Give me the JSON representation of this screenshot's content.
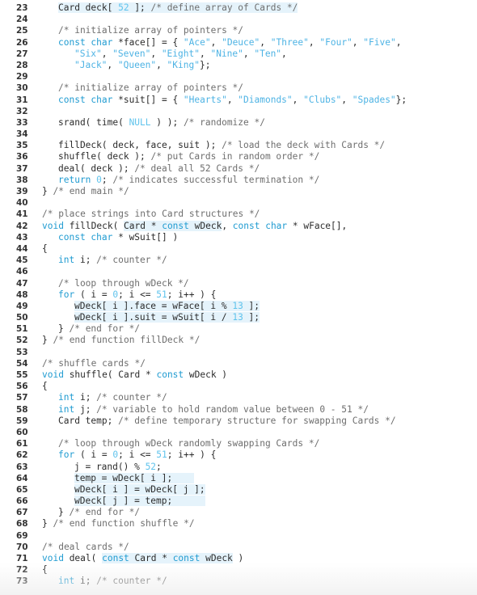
{
  "listing": {
    "colors": {
      "keyword": "#1f9bd1",
      "number": "#5fc3ec",
      "string": "#4db3e4",
      "comment": "#6e6e6e",
      "text": "#2b2b2b",
      "highlight": "#e5f3fb"
    },
    "lines": [
      {
        "n": "23",
        "indent": 1,
        "tokens": [
          {
            "t": "Card deck[ ",
            "c": "",
            "h": true
          },
          {
            "t": "52",
            "c": "num",
            "h": true
          },
          {
            "t": " ]; /* define array of Cards */",
            "c": "",
            "h": true,
            "split": "cm"
          }
        ]
      },
      {
        "n": "24",
        "indent": 0,
        "tokens": []
      },
      {
        "n": "25",
        "indent": 1,
        "tokens": [
          {
            "t": "/* initialize array of pointers */",
            "c": "cm"
          }
        ]
      },
      {
        "n": "26",
        "indent": 1,
        "tokens": [
          {
            "t": "const char",
            "c": "kw"
          },
          {
            "t": " *face[] = { ",
            "c": ""
          },
          {
            "t": "\"Ace\"",
            "c": "str"
          },
          {
            "t": ", ",
            "c": ""
          },
          {
            "t": "\"Deuce\"",
            "c": "str"
          },
          {
            "t": ", ",
            "c": ""
          },
          {
            "t": "\"Three\"",
            "c": "str"
          },
          {
            "t": ", ",
            "c": ""
          },
          {
            "t": "\"Four\"",
            "c": "str"
          },
          {
            "t": ", ",
            "c": ""
          },
          {
            "t": "\"Five\"",
            "c": "str"
          },
          {
            "t": ",",
            "c": ""
          }
        ]
      },
      {
        "n": "27",
        "indent": 2,
        "tokens": [
          {
            "t": "\"Six\"",
            "c": "str"
          },
          {
            "t": ", ",
            "c": ""
          },
          {
            "t": "\"Seven\"",
            "c": "str"
          },
          {
            "t": ", ",
            "c": ""
          },
          {
            "t": "\"Eight\"",
            "c": "str"
          },
          {
            "t": ", ",
            "c": ""
          },
          {
            "t": "\"Nine\"",
            "c": "str"
          },
          {
            "t": ", ",
            "c": ""
          },
          {
            "t": "\"Ten\"",
            "c": "str"
          },
          {
            "t": ",",
            "c": ""
          }
        ]
      },
      {
        "n": "28",
        "indent": 2,
        "tokens": [
          {
            "t": "\"Jack\"",
            "c": "str"
          },
          {
            "t": ", ",
            "c": ""
          },
          {
            "t": "\"Queen\"",
            "c": "str"
          },
          {
            "t": ", ",
            "c": ""
          },
          {
            "t": "\"King\"",
            "c": "str"
          },
          {
            "t": "};",
            "c": ""
          }
        ]
      },
      {
        "n": "29",
        "indent": 0,
        "tokens": []
      },
      {
        "n": "30",
        "indent": 1,
        "tokens": [
          {
            "t": "/* initialize array of pointers */",
            "c": "cm"
          }
        ]
      },
      {
        "n": "31",
        "indent": 1,
        "tokens": [
          {
            "t": "const char",
            "c": "kw"
          },
          {
            "t": " *suit[] = { ",
            "c": ""
          },
          {
            "t": "\"Hearts\"",
            "c": "str"
          },
          {
            "t": ", ",
            "c": ""
          },
          {
            "t": "\"Diamonds\"",
            "c": "str"
          },
          {
            "t": ", ",
            "c": ""
          },
          {
            "t": "\"Clubs\"",
            "c": "str"
          },
          {
            "t": ", ",
            "c": ""
          },
          {
            "t": "\"Spades\"",
            "c": "str"
          },
          {
            "t": "};",
            "c": ""
          }
        ]
      },
      {
        "n": "32",
        "indent": 0,
        "tokens": []
      },
      {
        "n": "33",
        "indent": 1,
        "tokens": [
          {
            "t": "srand( time( ",
            "c": ""
          },
          {
            "t": "NULL",
            "c": "num"
          },
          {
            "t": " ) ); ",
            "c": ""
          },
          {
            "t": "/* randomize */",
            "c": "cm"
          }
        ]
      },
      {
        "n": "34",
        "indent": 0,
        "tokens": []
      },
      {
        "n": "35",
        "indent": 1,
        "tokens": [
          {
            "t": "fillDeck( deck, face, suit ); ",
            "c": ""
          },
          {
            "t": "/* load the deck with Cards */",
            "c": "cm"
          }
        ]
      },
      {
        "n": "36",
        "indent": 1,
        "tokens": [
          {
            "t": "shuffle( deck ); ",
            "c": ""
          },
          {
            "t": "/* put Cards in random order */",
            "c": "cm"
          }
        ]
      },
      {
        "n": "37",
        "indent": 1,
        "tokens": [
          {
            "t": "deal( deck ); ",
            "c": ""
          },
          {
            "t": "/* deal all 52 Cards */",
            "c": "cm"
          }
        ]
      },
      {
        "n": "38",
        "indent": 1,
        "tokens": [
          {
            "t": "return",
            "c": "kw"
          },
          {
            "t": " ",
            "c": ""
          },
          {
            "t": "0",
            "c": "num"
          },
          {
            "t": "; ",
            "c": ""
          },
          {
            "t": "/* indicates successful termination */",
            "c": "cm"
          }
        ]
      },
      {
        "n": "39",
        "indent": 0,
        "tokens": [
          {
            "t": "} ",
            "c": ""
          },
          {
            "t": "/* end main */",
            "c": "cm"
          }
        ]
      },
      {
        "n": "40",
        "indent": 0,
        "tokens": []
      },
      {
        "n": "41",
        "indent": 0,
        "tokens": [
          {
            "t": "/* place strings into Card structures */",
            "c": "cm"
          }
        ]
      },
      {
        "n": "42",
        "indent": 0,
        "tokens": [
          {
            "t": "void",
            "c": "kw"
          },
          {
            "t": " fillDeck( ",
            "c": ""
          },
          {
            "t": "Card * ",
            "c": "",
            "h": true
          },
          {
            "t": "const",
            "c": "kw",
            "h": true
          },
          {
            "t": " wDeck",
            "c": "",
            "h": true
          },
          {
            "t": ", ",
            "c": ""
          },
          {
            "t": "const char",
            "c": "kw"
          },
          {
            "t": " * wFace[],",
            "c": ""
          }
        ]
      },
      {
        "n": "43",
        "indent": 1,
        "tokens": [
          {
            "t": "const char",
            "c": "kw"
          },
          {
            "t": " * wSuit[] )",
            "c": ""
          }
        ]
      },
      {
        "n": "44",
        "indent": 0,
        "tokens": [
          {
            "t": "{",
            "c": ""
          }
        ]
      },
      {
        "n": "45",
        "indent": 1,
        "tokens": [
          {
            "t": "int",
            "c": "kw"
          },
          {
            "t": " i; ",
            "c": ""
          },
          {
            "t": "/* counter */",
            "c": "cm"
          }
        ]
      },
      {
        "n": "46",
        "indent": 0,
        "tokens": []
      },
      {
        "n": "47",
        "indent": 1,
        "tokens": [
          {
            "t": "/* loop through wDeck */",
            "c": "cm"
          }
        ]
      },
      {
        "n": "48",
        "indent": 1,
        "tokens": [
          {
            "t": "for",
            "c": "kw"
          },
          {
            "t": " ( i = ",
            "c": ""
          },
          {
            "t": "0",
            "c": "num"
          },
          {
            "t": "; i <= ",
            "c": ""
          },
          {
            "t": "51",
            "c": "num"
          },
          {
            "t": "; i++ ) {",
            "c": ""
          }
        ]
      },
      {
        "n": "49",
        "indent": 2,
        "tokens": [
          {
            "t": "wDeck[ i ].face = wFace[ i % ",
            "c": "",
            "h": true
          },
          {
            "t": "13",
            "c": "num",
            "h": true
          },
          {
            "t": " ];",
            "c": "",
            "h": true
          }
        ]
      },
      {
        "n": "50",
        "indent": 2,
        "tokens": [
          {
            "t": "wDeck[ i ].suit = wSuit[ i / ",
            "c": "",
            "h": true
          },
          {
            "t": "13",
            "c": "num",
            "h": true
          },
          {
            "t": " ];",
            "c": "",
            "h": true
          }
        ]
      },
      {
        "n": "51",
        "indent": 1,
        "tokens": [
          {
            "t": "} ",
            "c": ""
          },
          {
            "t": "/* end for */",
            "c": "cm"
          }
        ]
      },
      {
        "n": "52",
        "indent": 0,
        "tokens": [
          {
            "t": "} ",
            "c": ""
          },
          {
            "t": "/* end function fillDeck */",
            "c": "cm"
          }
        ]
      },
      {
        "n": "53",
        "indent": 0,
        "tokens": []
      },
      {
        "n": "54",
        "indent": 0,
        "tokens": [
          {
            "t": "/* shuffle cards */",
            "c": "cm"
          }
        ]
      },
      {
        "n": "55",
        "indent": 0,
        "tokens": [
          {
            "t": "void",
            "c": "kw"
          },
          {
            "t": " shuffle( Card * ",
            "c": ""
          },
          {
            "t": "const",
            "c": "kw"
          },
          {
            "t": " wDeck )",
            "c": ""
          }
        ]
      },
      {
        "n": "56",
        "indent": 0,
        "tokens": [
          {
            "t": "{",
            "c": ""
          }
        ]
      },
      {
        "n": "57",
        "indent": 1,
        "tokens": [
          {
            "t": "int",
            "c": "kw"
          },
          {
            "t": " i; ",
            "c": ""
          },
          {
            "t": "/* counter */",
            "c": "cm"
          }
        ]
      },
      {
        "n": "58",
        "indent": 1,
        "tokens": [
          {
            "t": "int",
            "c": "kw"
          },
          {
            "t": " j; ",
            "c": ""
          },
          {
            "t": "/* variable to hold random value between 0 - 51 */",
            "c": "cm"
          }
        ]
      },
      {
        "n": "59",
        "indent": 1,
        "tokens": [
          {
            "t": "Card temp; ",
            "c": ""
          },
          {
            "t": "/* define temporary structure for swapping Cards */",
            "c": "cm"
          }
        ]
      },
      {
        "n": "60",
        "indent": 0,
        "tokens": []
      },
      {
        "n": "61",
        "indent": 1,
        "tokens": [
          {
            "t": "/* loop through wDeck randomly swapping Cards */",
            "c": "cm"
          }
        ]
      },
      {
        "n": "62",
        "indent": 1,
        "tokens": [
          {
            "t": "for",
            "c": "kw"
          },
          {
            "t": " ( i = ",
            "c": ""
          },
          {
            "t": "0",
            "c": "num"
          },
          {
            "t": "; i <= ",
            "c": ""
          },
          {
            "t": "51",
            "c": "num"
          },
          {
            "t": "; i++ ) {",
            "c": ""
          }
        ]
      },
      {
        "n": "63",
        "indent": 2,
        "tokens": [
          {
            "t": "j = rand() % ",
            "c": ""
          },
          {
            "t": "52",
            "c": "num"
          },
          {
            "t": ";",
            "c": ""
          }
        ]
      },
      {
        "n": "64",
        "indent": 2,
        "tokens": [
          {
            "t": "temp = wDeck[ i ];    ",
            "c": "",
            "h": true
          }
        ]
      },
      {
        "n": "65",
        "indent": 2,
        "tokens": [
          {
            "t": "wDeck[ i ] = wDeck[ j ];",
            "c": "",
            "h": true
          }
        ]
      },
      {
        "n": "66",
        "indent": 2,
        "tokens": [
          {
            "t": "wDeck[ j ] = temp;      ",
            "c": "",
            "h": true
          }
        ]
      },
      {
        "n": "67",
        "indent": 1,
        "tokens": [
          {
            "t": "} ",
            "c": ""
          },
          {
            "t": "/* end for */",
            "c": "cm"
          }
        ]
      },
      {
        "n": "68",
        "indent": 0,
        "tokens": [
          {
            "t": "} ",
            "c": ""
          },
          {
            "t": "/* end function shuffle */",
            "c": "cm"
          }
        ]
      },
      {
        "n": "69",
        "indent": 0,
        "tokens": []
      },
      {
        "n": "70",
        "indent": 0,
        "tokens": [
          {
            "t": "/* deal cards */",
            "c": "cm"
          }
        ]
      },
      {
        "n": "71",
        "indent": 0,
        "tokens": [
          {
            "t": "void",
            "c": "kw"
          },
          {
            "t": " deal( ",
            "c": ""
          },
          {
            "t": "const",
            "c": "kw",
            "h": true
          },
          {
            "t": " Card * ",
            "c": "",
            "h": true
          },
          {
            "t": "const",
            "c": "kw",
            "h": true
          },
          {
            "t": " wDeck",
            "c": "",
            "h": true
          },
          {
            "t": " )",
            "c": ""
          }
        ]
      },
      {
        "n": "72",
        "indent": 0,
        "tokens": [
          {
            "t": "{",
            "c": ""
          }
        ]
      },
      {
        "n": "73",
        "indent": 1,
        "tokens": [
          {
            "t": "int",
            "c": "kw"
          },
          {
            "t": " i; ",
            "c": ""
          },
          {
            "t": "/* counter */",
            "c": "cm"
          }
        ]
      }
    ]
  }
}
